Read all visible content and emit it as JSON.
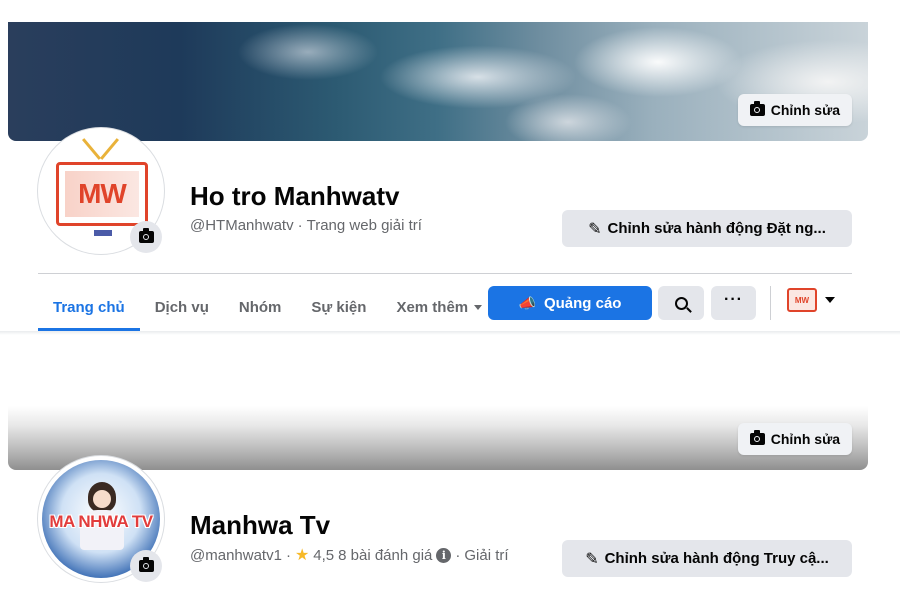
{
  "page1": {
    "edit_cover_label": "Chỉnh sửa",
    "avatar_text": "MW",
    "name": "Ho tro Manhwatv",
    "handle": "@HTManhwatv",
    "separator": "·",
    "category": "Trang web giải trí",
    "action_button": "Chỉnh sửa hành động Đặt ng...",
    "tabs": [
      {
        "label": "Trang chủ"
      },
      {
        "label": "Dịch vụ"
      },
      {
        "label": "Nhóm"
      },
      {
        "label": "Sự kiện"
      },
      {
        "label": "Xem thêm"
      }
    ],
    "ads_button": "Quảng cáo",
    "more_dots": "···",
    "switcher_avatar": "MW"
  },
  "page2": {
    "edit_cover_label": "Chỉnh sửa",
    "avatar_text": "MA NHWA TV",
    "name": "Manhwa Tv",
    "handle": "@manhwatv1",
    "separator": "·",
    "rating": "4,5",
    "reviews": "8 bài đánh giá",
    "info_glyph": "i",
    "category": "Giải trí",
    "action_button": "Chỉnh sửa hành động Truy cậ..."
  },
  "colors": {
    "accent": "#1b74e4",
    "button_gray": "#e4e6eb",
    "text_secondary": "#65676b"
  }
}
